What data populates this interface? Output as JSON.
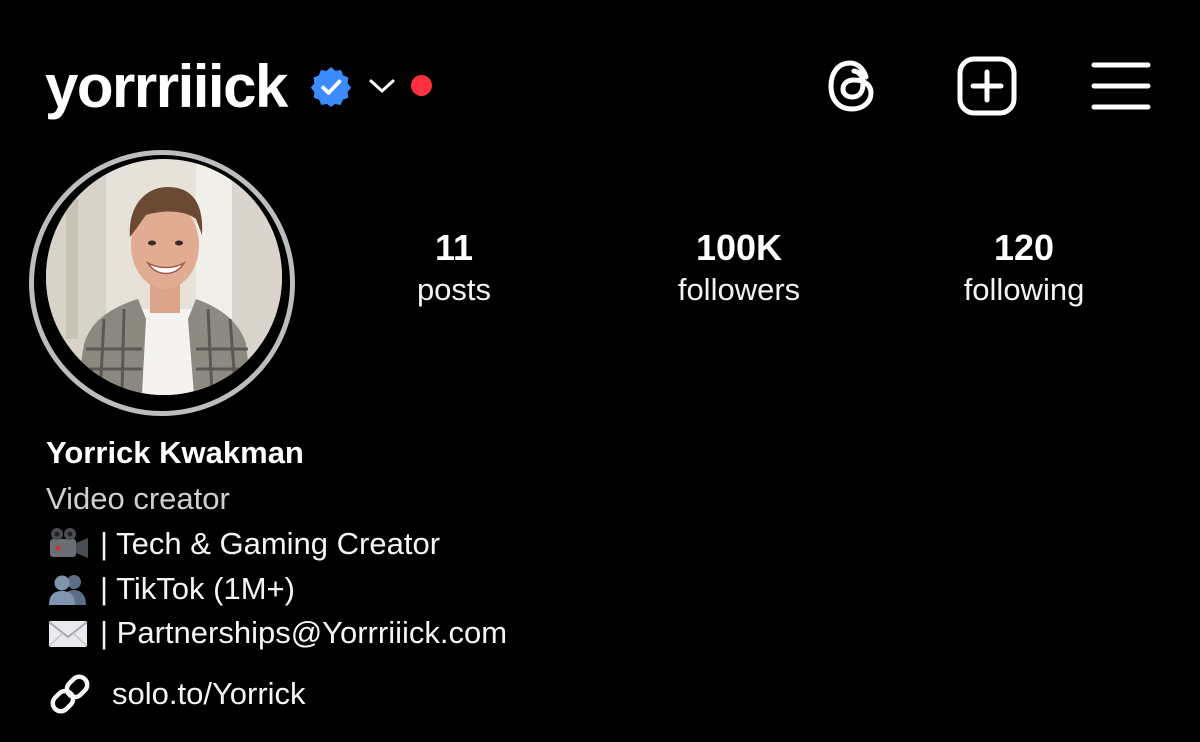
{
  "header": {
    "username": "yorrriiick",
    "verified_icon": "verified-badge-icon",
    "switcher_icon": "chevron-down-icon",
    "notification_dot_color": "#ff3040",
    "actions": [
      "threads-icon",
      "create-post-icon",
      "menu-icon"
    ]
  },
  "profile": {
    "avatar": "profile-photo",
    "stats": {
      "posts": {
        "value": "11",
        "label": "posts"
      },
      "followers": {
        "value": "100K",
        "label": "followers"
      },
      "following": {
        "value": "120",
        "label": "following"
      }
    },
    "display_name": "Yorrick Kwakman",
    "category": "Video creator",
    "bio_lines": [
      {
        "icon": "movie-camera-emoji",
        "text": "| Tech & Gaming Creator"
      },
      {
        "icon": "busts-emoji",
        "text": "| TikTok (1M+)"
      },
      {
        "icon": "envelope-emoji",
        "text": "| Partnerships@Yorrriiick.com"
      }
    ],
    "link": {
      "icon": "link-icon",
      "text": "solo.to/Yorrick"
    }
  },
  "colors": {
    "background": "#000000",
    "verified": "#3b8bff",
    "text": "#f5f5f5"
  }
}
